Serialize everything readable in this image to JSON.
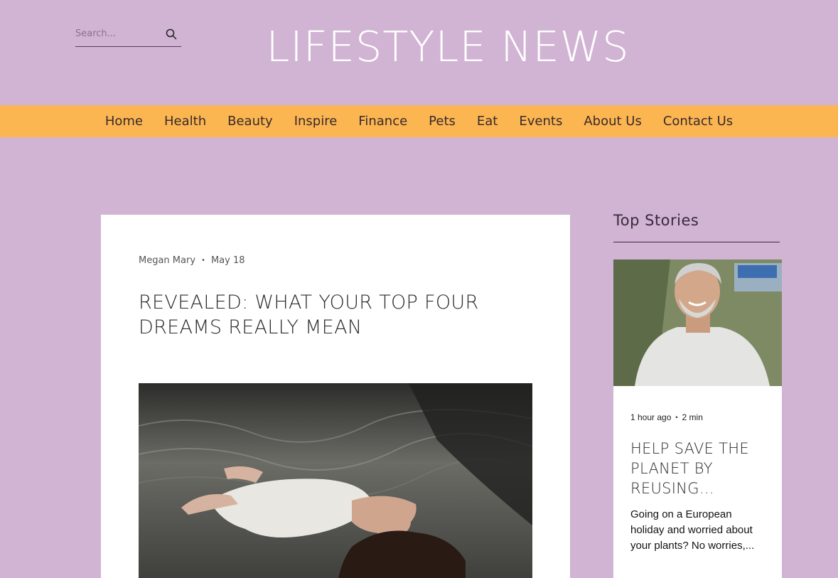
{
  "search": {
    "placeholder": "Search..."
  },
  "site": {
    "title": "LIFESTYLE NEWS"
  },
  "nav": {
    "items": [
      "Home",
      "Health",
      "Beauty",
      "Inspire",
      "Finance",
      "Pets",
      "Eat",
      "Events",
      "About Us",
      "Contact Us"
    ]
  },
  "article": {
    "author": "Megan Mary",
    "date": "May 18",
    "title": "REVEALED: WHAT YOUR TOP FOUR DREAMS REALLY MEAN"
  },
  "sidebar": {
    "heading": "Top Stories",
    "story": {
      "time": "1 hour ago",
      "read_time": "2 min",
      "title": "HELP SAVE THE PLANET BY REUSING...",
      "excerpt": "Going on a European holiday and worried about your plants? No worries,..."
    }
  },
  "colors": {
    "background": "#d1b3d3",
    "nav_bar": "#fbb652",
    "title_text": "#ffffff"
  }
}
